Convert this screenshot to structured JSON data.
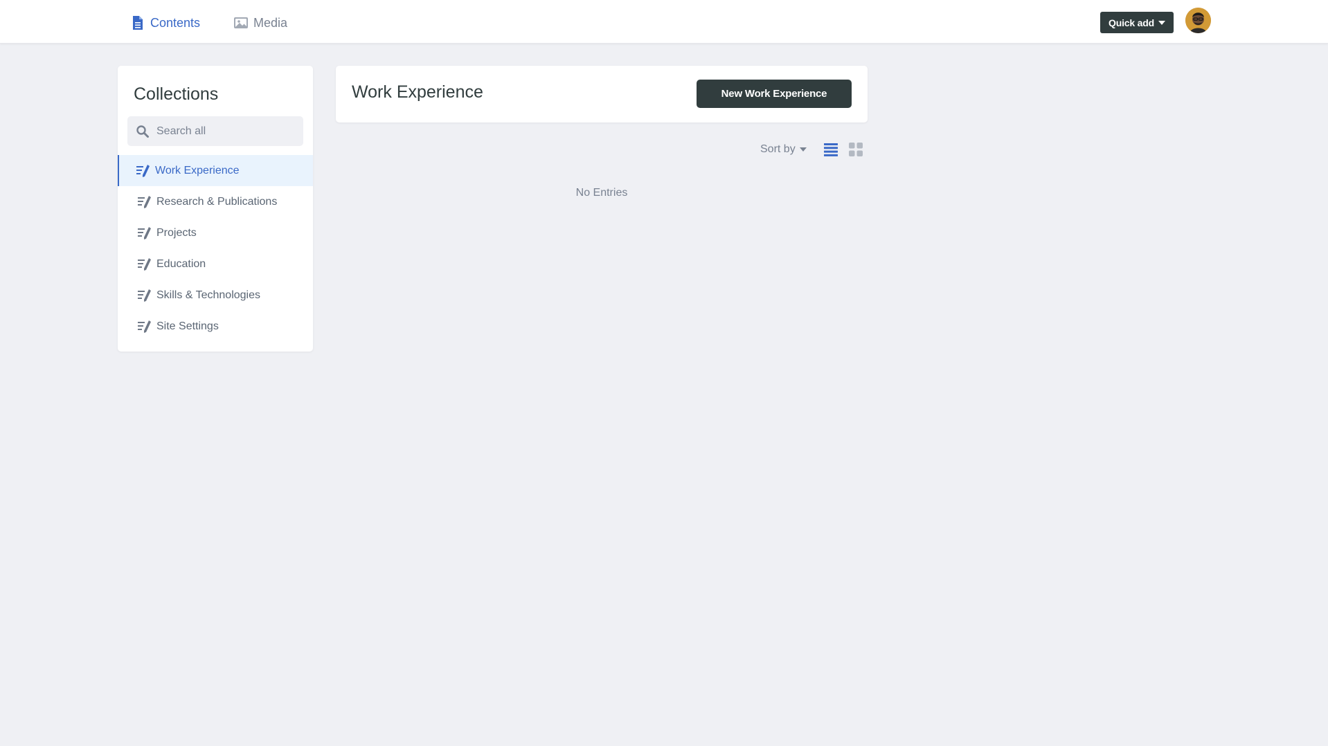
{
  "nav": {
    "contents_label": "Contents",
    "media_label": "Media"
  },
  "header": {
    "quick_add_label": "Quick add"
  },
  "sidebar": {
    "title": "Collections",
    "search_placeholder": "Search all",
    "items": [
      {
        "label": "Work Experience",
        "active": true
      },
      {
        "label": "Research & Publications",
        "active": false
      },
      {
        "label": "Projects",
        "active": false
      },
      {
        "label": "Education",
        "active": false
      },
      {
        "label": "Skills & Technologies",
        "active": false
      },
      {
        "label": "Site Settings",
        "active": false
      }
    ]
  },
  "main": {
    "title": "Work Experience",
    "new_button_label": "New Work Experience",
    "sort_label": "Sort by",
    "empty_message": "No Entries"
  },
  "icons": {
    "contents": "document-icon",
    "media": "image-icon",
    "search": "search-icon",
    "collection": "collection-pencil-icon",
    "list_view": "list-view-icon",
    "grid_view": "grid-view-icon"
  },
  "colors": {
    "accent": "#3a69c7",
    "dark_button": "#313d3e",
    "background": "#eff0f4",
    "muted_text": "#798291",
    "active_item_bg": "#e9f3fd"
  }
}
